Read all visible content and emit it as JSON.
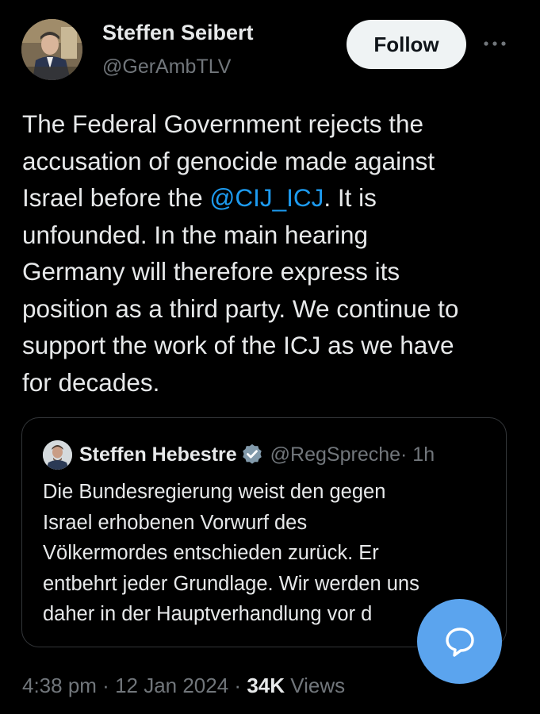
{
  "author": {
    "name": "Steffen Seibert",
    "handle": "@GerAmbTLV",
    "avatar_icon": "profile-photo"
  },
  "follow_label": "Follow",
  "more_icon": "more-horizontal-icon",
  "tweet": {
    "lines": [
      {
        "text": "The Federal Government rejects the"
      },
      {
        "text": "accusation of genocide made against"
      },
      {
        "before": "Israel before the ",
        "mention": "@CIJ_ICJ",
        "after": ". It is"
      },
      {
        "text": "unfounded. In the main hearing"
      },
      {
        "text": "Germany will therefore express its"
      },
      {
        "text": "position as a third party. We continue to"
      },
      {
        "text": "support the work of the ICJ as we have"
      },
      {
        "text": "for decades."
      }
    ]
  },
  "quote": {
    "name": "Steffen Hebestre",
    "handle": "@RegSpreche",
    "time": "· 1h",
    "verified_icon": "verified-badge-icon",
    "lines": [
      "Die Bundesregierung weist den gegen",
      "Israel erhobenen Vorwurf des",
      "Völkermordes entschieden zurück. Er",
      "entbehrt jeder Grundlage. Wir werden uns",
      "daher in der Hauptverhandlung vor d"
    ]
  },
  "meta": {
    "time": "4:38 pm",
    "sep1": " · ",
    "date": "12 Jan 2024",
    "sep2": " · ",
    "views_count": "34K",
    "views_label": " Views"
  },
  "reply_fab_icon": "reply-bubble-icon",
  "colors": {
    "background": "#000000",
    "text": "#e7e9ea",
    "secondary": "#71767b",
    "link": "#1d9bf0",
    "fab": "#5ba4ee",
    "verified": "#829aab"
  }
}
